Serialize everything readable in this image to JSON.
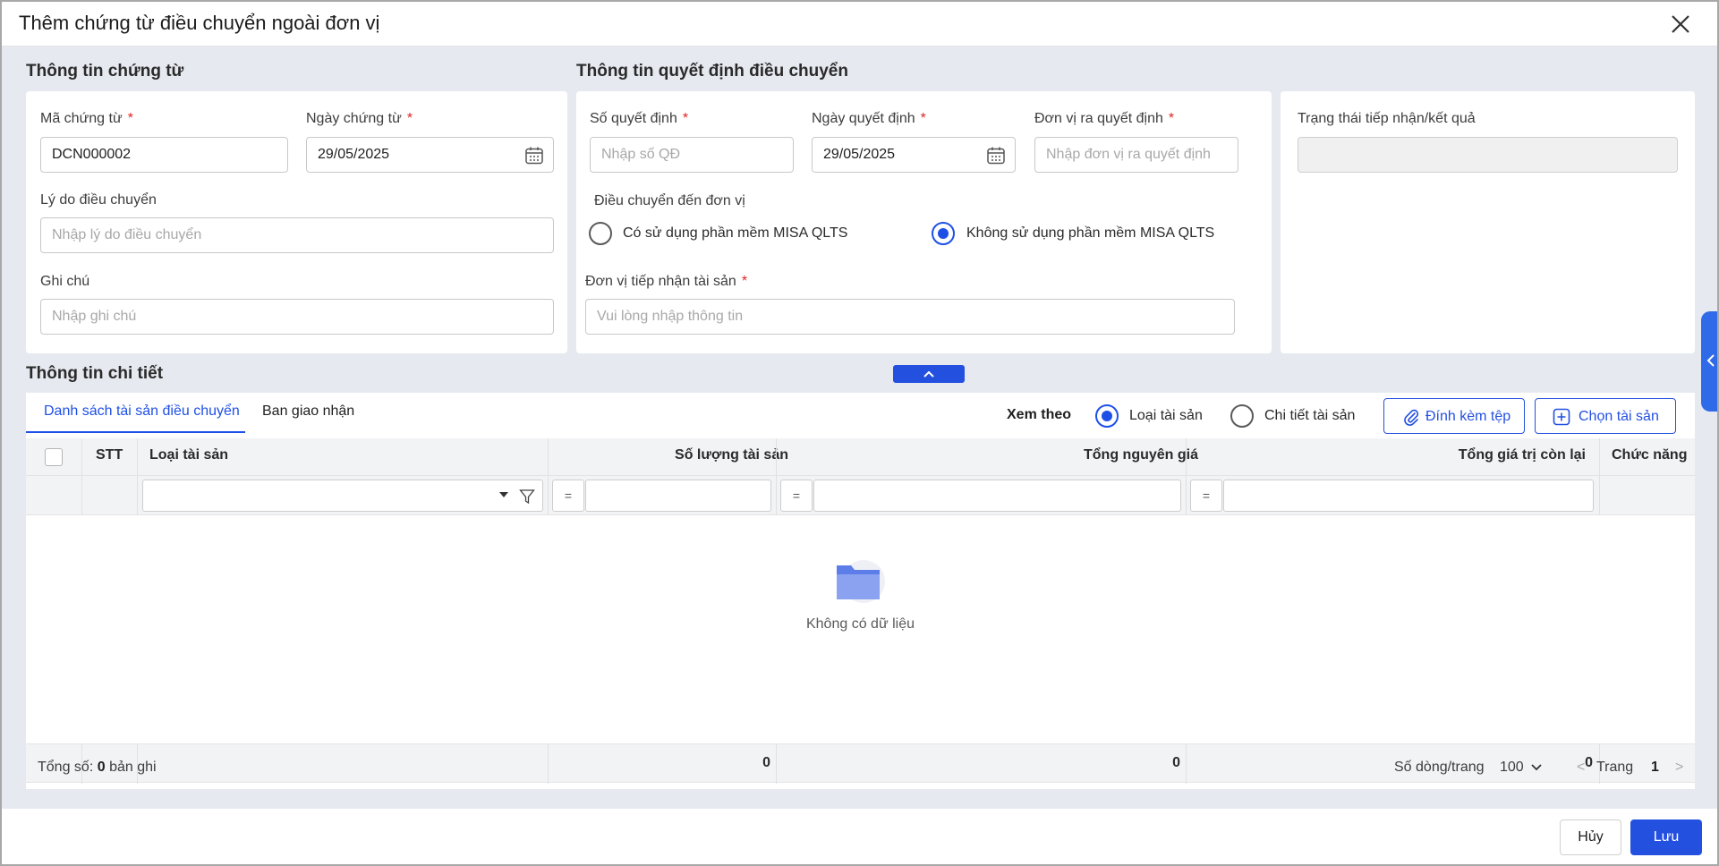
{
  "dialog": {
    "title": "Thêm chứng từ điều chuyển ngoài đơn vị"
  },
  "voucher": {
    "section_title": "Thông tin chứng từ",
    "code_label": "Mã chứng từ",
    "code_value": "DCN000002",
    "date_label": "Ngày chứng từ",
    "date_value": "29/05/2025",
    "reason_label": "Lý do điều chuyển",
    "reason_placeholder": "Nhập lý do điều chuyển",
    "note_label": "Ghi chú",
    "note_placeholder": "Nhập ghi chú",
    "required_mark": "*"
  },
  "decision": {
    "section_title": "Thông tin quyết định điều chuyển",
    "number_label": "Số quyết định",
    "number_placeholder": "Nhập số QĐ",
    "date_label": "Ngày quyết định",
    "date_value": "29/05/2025",
    "issuer_label": "Đơn vị ra quyết định",
    "issuer_placeholder": "Nhập đơn vị ra quyết định",
    "transfer_to_label": "Điều chuyển đến đơn vị",
    "radio_uses_misa": "Có sử dụng phần mềm MISA QLTS",
    "radio_no_misa": "Không sử dụng phần mềm MISA QLTS",
    "selected_radio": "no_misa",
    "receiver_label": "Đơn vị tiếp nhận tài sản",
    "receiver_placeholder": "Vui lòng nhập thông tin"
  },
  "status": {
    "label": "Trạng thái tiếp nhận/kết quả",
    "value": ""
  },
  "detail": {
    "section_title": "Thông tin chi tiết",
    "tabs": [
      {
        "label": "Danh sách tài sản điều chuyển",
        "active": true
      },
      {
        "label": "Ban giao nhận",
        "active": false
      }
    ],
    "view_by_label": "Xem theo",
    "view_options": [
      {
        "label": "Loại tài sản",
        "selected": true
      },
      {
        "label": "Chi tiết tài sản",
        "selected": false
      }
    ],
    "attach_button": "Đính kèm tệp",
    "choose_button": "Chọn tài sản"
  },
  "grid": {
    "columns": [
      "STT",
      "Loại tài sản",
      "Số lượng tài sản",
      "Tổng nguyên giá",
      "Tổng giá trị còn lại",
      "Chức năng"
    ],
    "filter_operator": "=",
    "empty_text": "Không có dữ liệu",
    "totals": {
      "quantity": "0",
      "original_cost": "0",
      "remaining_value": "0"
    }
  },
  "pager": {
    "total_prefix": "Tổng số:",
    "total_count": "0",
    "total_suffix": "bản ghi",
    "rows_per_page_label": "Số dòng/trang",
    "rows_per_page_value": "100",
    "page_label": "Trang",
    "page_value": "1",
    "prev": "<",
    "next": ">"
  },
  "footer": {
    "cancel": "Hủy",
    "save": "Lưu"
  },
  "colors": {
    "accent": "#2450E0",
    "required": "#E02424",
    "side_tab": "#2F6AE8"
  }
}
